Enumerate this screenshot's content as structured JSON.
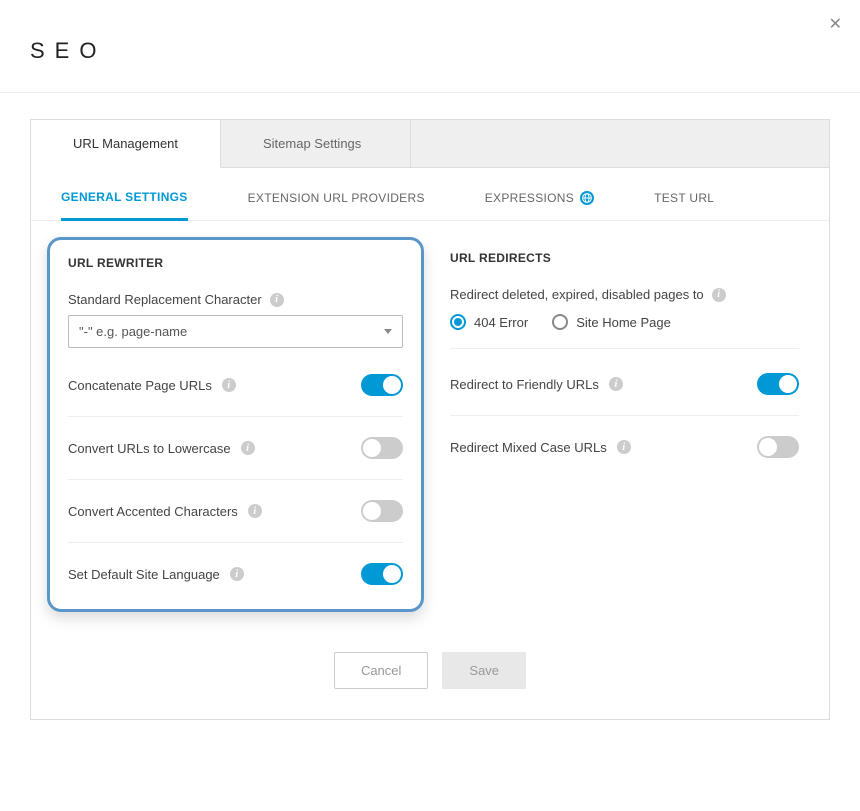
{
  "page": {
    "title": "SEO"
  },
  "tabs_primary": [
    {
      "label": "URL Management",
      "active": true
    },
    {
      "label": "Sitemap Settings",
      "active": false
    }
  ],
  "tabs_secondary": [
    {
      "label": "GENERAL SETTINGS",
      "active": true
    },
    {
      "label": "EXTENSION URL PROVIDERS",
      "active": false
    },
    {
      "label": "EXPRESSIONS",
      "active": false,
      "globe": true
    },
    {
      "label": "TEST URL",
      "active": false
    }
  ],
  "rewriter": {
    "title": "URL REWRITER",
    "replacement_label": "Standard Replacement Character",
    "replacement_value": "\"-\" e.g. page-name",
    "settings": [
      {
        "label": "Concatenate Page URLs",
        "on": true
      },
      {
        "label": "Convert URLs to Lowercase",
        "on": false
      },
      {
        "label": "Convert Accented Characters",
        "on": false
      },
      {
        "label": "Set Default Site Language",
        "on": true
      }
    ]
  },
  "redirects": {
    "title": "URL REDIRECTS",
    "deleted_label": "Redirect deleted, expired, disabled pages to",
    "options": [
      {
        "label": "404 Error",
        "checked": true
      },
      {
        "label": "Site Home Page",
        "checked": false
      }
    ],
    "settings": [
      {
        "label": "Redirect to Friendly URLs",
        "on": true
      },
      {
        "label": "Redirect Mixed Case URLs",
        "on": false
      }
    ]
  },
  "buttons": {
    "cancel": "Cancel",
    "save": "Save"
  },
  "icons": {
    "info": "i"
  }
}
